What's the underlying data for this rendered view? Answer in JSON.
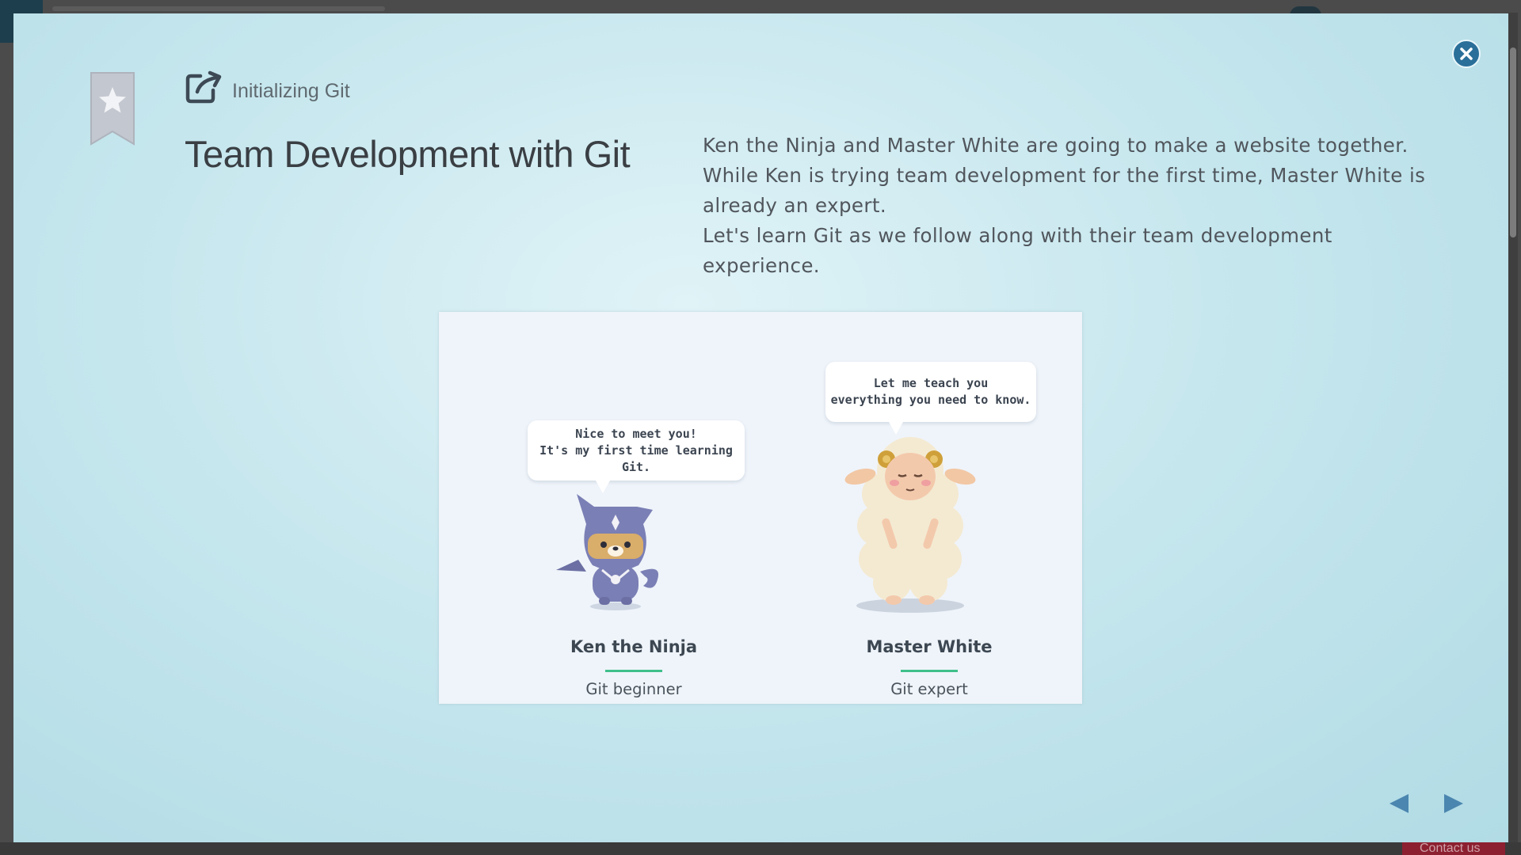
{
  "modal": {
    "chapter_label": "Initializing Git",
    "course_title": "Team Development with Git",
    "description": [
      "Ken the Ninja and Master White are going to make a website together.",
      "While Ken is trying team development for the first time, Master White is already an expert.",
      "Let's learn Git as we follow along with their team development experience."
    ]
  },
  "illustration": {
    "ken": {
      "speech_line1": "Nice to meet you!",
      "speech_line2": "It's my first time learning Git.",
      "name": "Ken the Ninja",
      "role": "Git beginner"
    },
    "white": {
      "speech_line1": "Let me teach you",
      "speech_line2": "everything you need to know.",
      "name": "Master White",
      "role": "Git expert"
    }
  },
  "background": {
    "contact_label": "Contact us"
  },
  "colors": {
    "accent": "#2a6f99",
    "underline": "#3fbf8a",
    "nav_arrow": "#4b86b0"
  }
}
